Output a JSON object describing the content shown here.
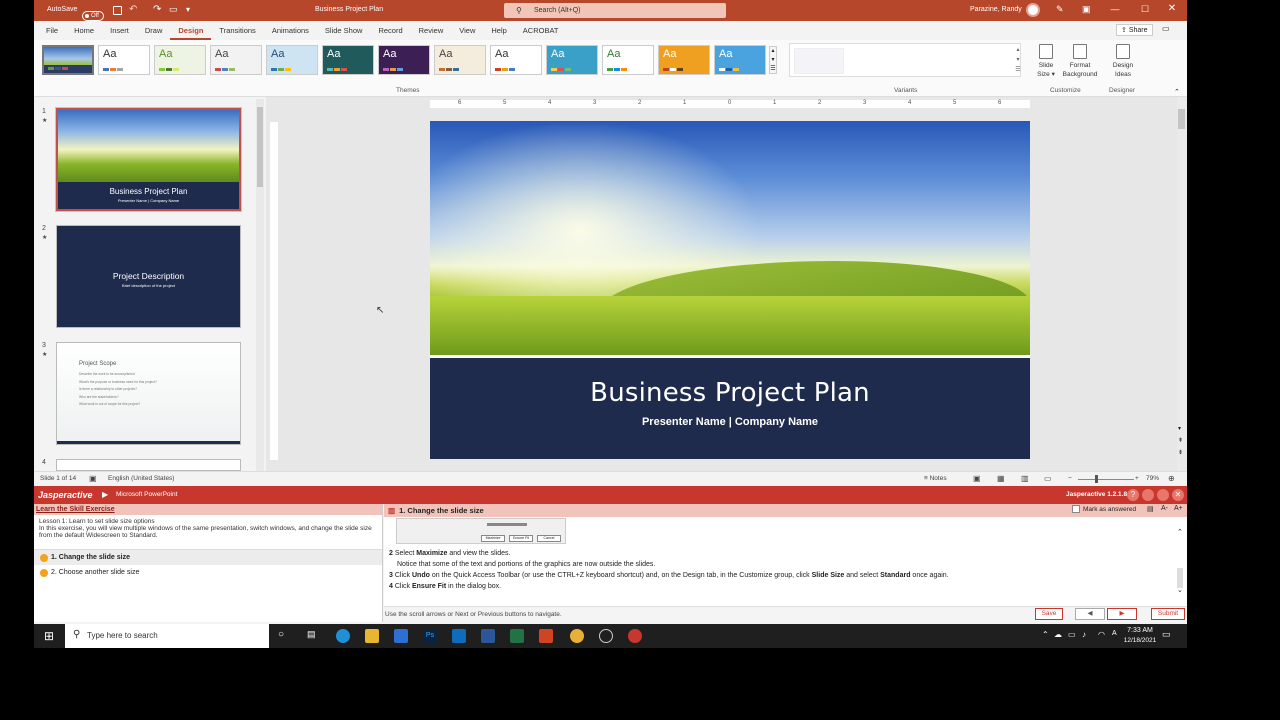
{
  "titlebar": {
    "autosave_label": "AutoSave",
    "autosave_state": "Off",
    "doc_title": "Business Project Plan",
    "search_placeholder": "Search (Alt+Q)",
    "user_name": "Parazine, Randy"
  },
  "tabs": [
    "File",
    "Home",
    "Insert",
    "Draw",
    "Design",
    "Transitions",
    "Animations",
    "Slide Show",
    "Record",
    "Review",
    "View",
    "Help",
    "ACROBAT"
  ],
  "active_tab": "Design",
  "ribbon": {
    "share_label": "Share",
    "themes_group": "Themes",
    "variants_group": "Variants",
    "customize_group": "Customize",
    "designer_group": "Designer",
    "slide_size_label": "Slide Size",
    "format_bg_label": "Format Background",
    "design_ideas_label": "Design Ideas",
    "theme_sample": "Aa",
    "themes": [
      {
        "bg": "#e6efe0",
        "fg": "#333",
        "c1": "#6a9a3a",
        "c2": "#2e5a88",
        "c3": "#c0504d"
      },
      {
        "bg": "#ffffff",
        "fg": "#333",
        "c1": "#4472c4",
        "c2": "#ed7d31",
        "c3": "#a5a5a5"
      },
      {
        "bg": "#eef4e3",
        "fg": "#5a8f29",
        "c1": "#8cc63f",
        "c2": "#4a7c2c",
        "c3": "#d9e86a"
      },
      {
        "bg": "#f2f2f2",
        "fg": "#444",
        "c1": "#c0504d",
        "c2": "#4f81bd",
        "c3": "#9bbb59"
      },
      {
        "bg": "#cfe4f2",
        "fg": "#1f4e79",
        "c1": "#2e75b6",
        "c2": "#70ad47",
        "c3": "#ffc000"
      },
      {
        "bg": "#215a5a",
        "fg": "#ffffff",
        "c1": "#60b5b5",
        "c2": "#f0a030",
        "c3": "#e05050"
      },
      {
        "bg": "#3b1f55",
        "fg": "#ffffff",
        "c1": "#c060c0",
        "c2": "#e0a040",
        "c3": "#60a0e0"
      },
      {
        "bg": "#f4ecdc",
        "fg": "#444",
        "c1": "#c07030",
        "c2": "#806040",
        "c3": "#3070a0"
      },
      {
        "bg": "#ffffff",
        "fg": "#333",
        "c1": "#d04020",
        "c2": "#e0a020",
        "c3": "#4080c0"
      },
      {
        "bg": "#3aa0c8",
        "fg": "#ffffff",
        "c1": "#f0d040",
        "c2": "#e05050",
        "c3": "#70c070"
      },
      {
        "bg": "#ffffff",
        "fg": "#2e7d32",
        "c1": "#43a047",
        "c2": "#1e88e5",
        "c3": "#fb8c00"
      },
      {
        "bg": "#f0a020",
        "fg": "#ffffff",
        "c1": "#c04020",
        "c2": "#ffffff",
        "c3": "#604020"
      },
      {
        "bg": "#4aa3df",
        "fg": "#ffffff",
        "c1": "#ffffff",
        "c2": "#1f5f9f",
        "c3": "#f0c040"
      }
    ]
  },
  "ruler_ticks": [
    "6",
    "5",
    "4",
    "3",
    "2",
    "1",
    "0",
    "1",
    "2",
    "3",
    "4",
    "5",
    "6"
  ],
  "thumbnails": [
    {
      "num": "1",
      "title": "Business Project Plan",
      "subtitle": "Presenter Name | Company Name"
    },
    {
      "num": "2",
      "title": "Project Description",
      "subtitle": "Brief description of the project"
    },
    {
      "num": "3",
      "title": "Project Scope",
      "bullets": [
        "Describe the work to be accomplished",
        "What's the purpose or business need for this project?",
        "Is there a relationship to other projects?",
        "Who are the stakeholders?",
        "What work is out of scope for this project?"
      ]
    },
    {
      "num": "4"
    }
  ],
  "slide": {
    "title": "Business Project Plan",
    "subtitle": "Presenter Name | Company Name"
  },
  "status": {
    "slide_info": "Slide 1 of 14",
    "language": "English (United States)",
    "notes_label": "Notes",
    "zoom": "79%"
  },
  "jasper": {
    "brand": "Jasperactive",
    "app": "Microsoft PowerPoint",
    "version": "Jasperactive 1.2.1.8",
    "exercise_title": "Learn the Skill Exercise",
    "lesson_title": "Lesson 1: Learn to set slide size options",
    "lesson_desc": "In this exercise, you will view multiple windows of the same presentation, switch windows, and change the slide size from the default Widescreen to Standard.",
    "tasks": [
      "1. Change the slide size",
      "2. Choose another slide size"
    ],
    "step_header": "1. Change the slide size",
    "mark_answered": "Mark as answered",
    "dialog_buttons": [
      "Maximize",
      "Ensure Fit",
      "Cancel"
    ],
    "steps": [
      {
        "n": "2",
        "pre": "Select ",
        "b1": "Maximize",
        "post": " and view the slides.",
        "b2": "",
        "tail": "",
        "b3": "",
        "end": ""
      },
      {
        "n": "",
        "pre": "Notice that some of the text and portions of the graphics are now outside the slides.",
        "b1": "",
        "post": "",
        "b2": "",
        "tail": "",
        "b3": "",
        "end": ""
      },
      {
        "n": "3",
        "pre": "Click ",
        "b1": "Undo",
        "post": " on the Quick Access Toolbar (or use the CTRL+Z keyboard shortcut) and, on the Design tab, in the Customize group, click ",
        "b2": "Slide Size",
        "tail": " and select ",
        "b3": "Standard",
        "end": " once again."
      },
      {
        "n": "4",
        "pre": "Click ",
        "b1": "Ensure Fit",
        "post": " in the dialog box.",
        "b2": "",
        "tail": "",
        "b3": "",
        "end": ""
      }
    ],
    "nav_hint": "Use the scroll arrows or Next or Previous buttons to navigate.",
    "save_label": "Save",
    "submit_label": "Submit"
  },
  "taskbar": {
    "search_placeholder": "Type here to search",
    "time": "7:33 AM",
    "date": "12/18/2021"
  }
}
